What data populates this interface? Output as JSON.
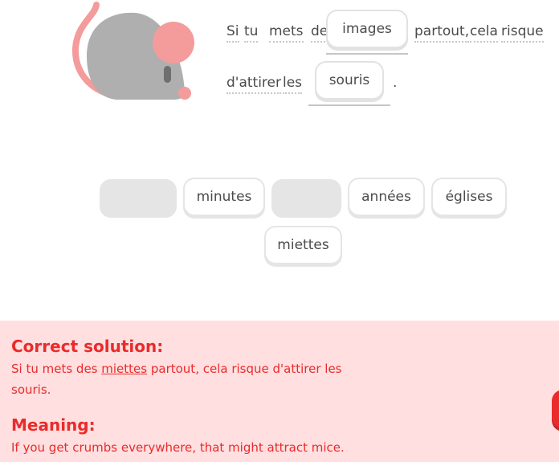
{
  "sentence": {
    "w1": "Si",
    "w2": "tu",
    "w3": "mets",
    "w4": "des",
    "slot1_word": "images",
    "w5": "partout,",
    "w6": "cela",
    "w7": "risque",
    "w8": "d'attirer",
    "w9": "les",
    "slot2_word": "souris",
    "period": "."
  },
  "word_bank": {
    "tile_minutes": "minutes",
    "tile_annees": "années",
    "tile_eglises": "églises",
    "tile_miettes": "miettes"
  },
  "feedback": {
    "solution_heading": "Correct solution:",
    "solution_before": "Si tu mets des ",
    "solution_keyword": "miettes",
    "solution_after": " partout, cela risque d'attirer les souris.",
    "meaning_heading": "Meaning:",
    "meaning_text": "If you get crumbs everywhere, that might attract mice."
  },
  "colors": {
    "feedback_bg": "#ffdfe0",
    "feedback_text": "#ea2b2b",
    "mouse_body": "#afafaf",
    "mouse_pink": "#f49b9b"
  },
  "icons": {
    "illustration": "mouse-icon"
  }
}
